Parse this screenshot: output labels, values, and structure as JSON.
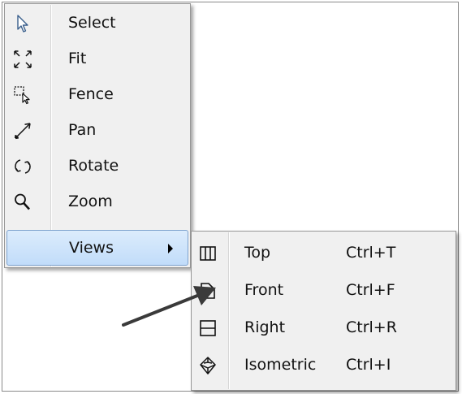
{
  "main_menu": {
    "items": [
      {
        "label": "Select",
        "icon": "cursor-arrow-icon"
      },
      {
        "label": "Fit",
        "icon": "fit-expand-icon"
      },
      {
        "label": "Fence",
        "icon": "fence-select-icon"
      },
      {
        "label": "Pan",
        "icon": "pan-diagonal-icon"
      },
      {
        "label": "Rotate",
        "icon": "rotate-icon"
      },
      {
        "label": "Zoom",
        "icon": "magnifier-icon"
      },
      {
        "label": "Views",
        "icon": "",
        "has_submenu": true,
        "highlighted": true
      }
    ]
  },
  "views_submenu": {
    "items": [
      {
        "label": "Top",
        "shortcut": "Ctrl+T",
        "icon": "top-view-icon"
      },
      {
        "label": "Front",
        "shortcut": "Ctrl+F",
        "icon": "front-view-icon"
      },
      {
        "label": "Right",
        "shortcut": "Ctrl+R",
        "icon": "right-view-icon"
      },
      {
        "label": "Isometric",
        "shortcut": "Ctrl+I",
        "icon": "isometric-view-icon"
      }
    ]
  },
  "colors": {
    "menu_bg": "#f0f0f0",
    "highlight_top": "#dcecfc",
    "highlight_bottom": "#c1dcfa",
    "highlight_border": "#7da2ce",
    "annotation_arrow": "#3a3a3a"
  }
}
